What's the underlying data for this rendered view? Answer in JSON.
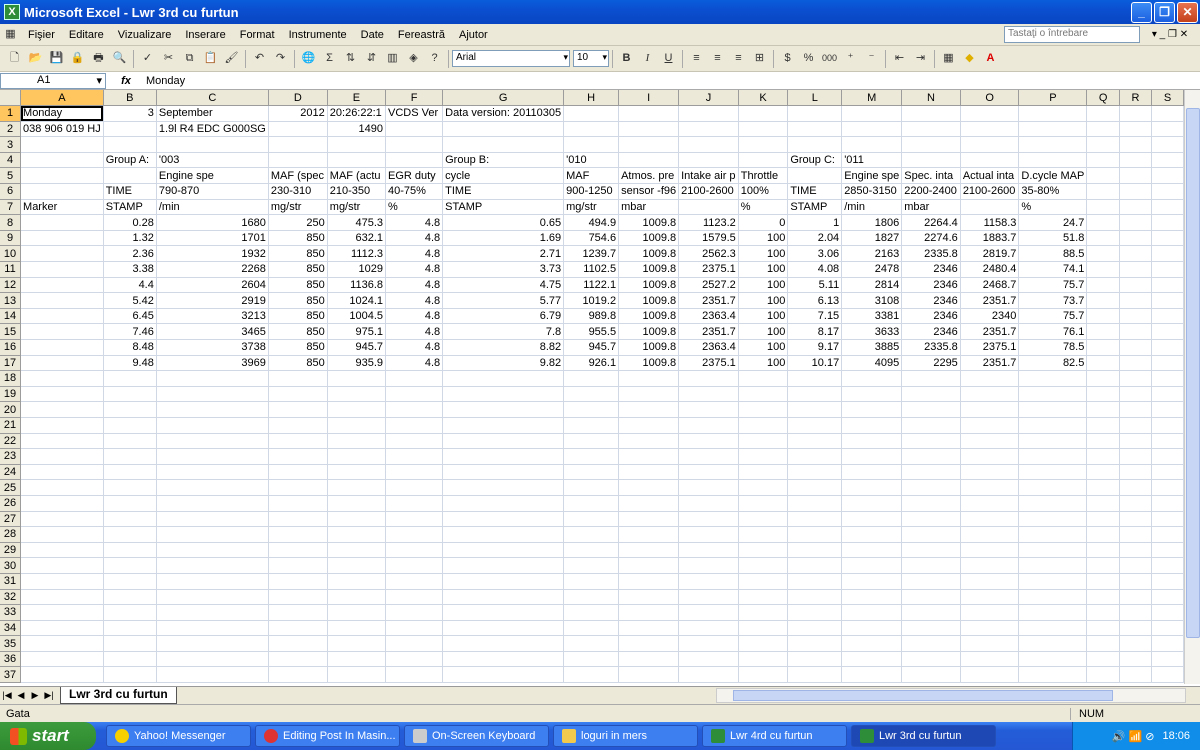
{
  "window": {
    "title": "Microsoft Excel - Lwr 3rd cu furtun",
    "app_icon": "X"
  },
  "menu": [
    "Fişier",
    "Editare",
    "Vizualizare",
    "Inserare",
    "Format",
    "Instrumente",
    "Date",
    "Fereastră",
    "Ajutor"
  ],
  "ask_box": {
    "placeholder": "Tastaţi o întrebare"
  },
  "toolbar": {
    "font": "Arial",
    "size": "10",
    "percent": "%",
    "thousands": "000"
  },
  "formula_bar": {
    "cell": "A1",
    "fx": "fx",
    "value": "Monday"
  },
  "columns": [
    "A",
    "B",
    "C",
    "D",
    "E",
    "F",
    "G",
    "H",
    "I",
    "J",
    "K",
    "L",
    "M",
    "N",
    "O",
    "P",
    "Q",
    "R",
    "S"
  ],
  "rows": [
    [
      "Monday",
      "3",
      "September",
      "2012",
      "20:26:22:1",
      "VCDS Ver",
      "Data version: 20110305",
      "",
      "",
      "",
      "",
      "",
      "",
      "",
      "",
      "",
      "",
      "",
      ""
    ],
    [
      "038 906 019 HJ",
      "",
      "1.9l R4 EDC G000SG",
      "",
      "1490",
      "",
      "",
      "",
      "",
      "",
      "",
      "",
      "",
      "",
      "",
      "",
      "",
      "",
      ""
    ],
    [
      "",
      "",
      "",
      "",
      "",
      "",
      "",
      "",
      "",
      "",
      "",
      "",
      "",
      "",
      "",
      "",
      "",
      "",
      ""
    ],
    [
      "",
      "Group A:",
      "'003",
      "",
      "",
      "",
      "Group B:",
      "'010",
      "",
      "",
      "",
      "Group C:",
      "'011",
      "",
      "",
      "",
      "",
      "",
      ""
    ],
    [
      "",
      "",
      "Engine spe",
      "MAF (spec",
      "MAF (actu",
      "EGR duty",
      "cycle",
      "MAF",
      "Atmos. pre",
      "Intake air p",
      "Throttle",
      "",
      "Engine spe",
      "Spec. inta",
      "Actual inta",
      "D.cycle MAP",
      "",
      "",
      ""
    ],
    [
      "",
      "TIME",
      "790-870",
      "230-310",
      "210-350",
      "40-75%",
      "TIME",
      "900-1250",
      "sensor -f96",
      "2100-2600",
      "100%",
      "TIME",
      "2850-3150",
      "2200-2400",
      "2100-2600",
      "35-80%",
      "",
      "",
      ""
    ],
    [
      "Marker",
      "STAMP",
      "/min",
      "mg/str",
      "mg/str",
      "%",
      "STAMP",
      "mg/str",
      "mbar",
      "",
      "%",
      "STAMP",
      "/min",
      "mbar",
      "",
      "%",
      "",
      "",
      ""
    ],
    [
      "",
      "0.28",
      "1680",
      "250",
      "475.3",
      "4.8",
      "0.65",
      "494.9",
      "1009.8",
      "1123.2",
      "0",
      "1",
      "1806",
      "2264.4",
      "1158.3",
      "24.7",
      "",
      "",
      ""
    ],
    [
      "",
      "1.32",
      "1701",
      "850",
      "632.1",
      "4.8",
      "1.69",
      "754.6",
      "1009.8",
      "1579.5",
      "100",
      "2.04",
      "1827",
      "2274.6",
      "1883.7",
      "51.8",
      "",
      "",
      ""
    ],
    [
      "",
      "2.36",
      "1932",
      "850",
      "1112.3",
      "4.8",
      "2.71",
      "1239.7",
      "1009.8",
      "2562.3",
      "100",
      "3.06",
      "2163",
      "2335.8",
      "2819.7",
      "88.5",
      "",
      "",
      ""
    ],
    [
      "",
      "3.38",
      "2268",
      "850",
      "1029",
      "4.8",
      "3.73",
      "1102.5",
      "1009.8",
      "2375.1",
      "100",
      "4.08",
      "2478",
      "2346",
      "2480.4",
      "74.1",
      "",
      "",
      ""
    ],
    [
      "",
      "4.4",
      "2604",
      "850",
      "1136.8",
      "4.8",
      "4.75",
      "1122.1",
      "1009.8",
      "2527.2",
      "100",
      "5.11",
      "2814",
      "2346",
      "2468.7",
      "75.7",
      "",
      "",
      ""
    ],
    [
      "",
      "5.42",
      "2919",
      "850",
      "1024.1",
      "4.8",
      "5.77",
      "1019.2",
      "1009.8",
      "2351.7",
      "100",
      "6.13",
      "3108",
      "2346",
      "2351.7",
      "73.7",
      "",
      "",
      ""
    ],
    [
      "",
      "6.45",
      "3213",
      "850",
      "1004.5",
      "4.8",
      "6.79",
      "989.8",
      "1009.8",
      "2363.4",
      "100",
      "7.15",
      "3381",
      "2346",
      "2340",
      "75.7",
      "",
      "",
      ""
    ],
    [
      "",
      "7.46",
      "3465",
      "850",
      "975.1",
      "4.8",
      "7.8",
      "955.5",
      "1009.8",
      "2351.7",
      "100",
      "8.17",
      "3633",
      "2346",
      "2351.7",
      "76.1",
      "",
      "",
      ""
    ],
    [
      "",
      "8.48",
      "3738",
      "850",
      "945.7",
      "4.8",
      "8.82",
      "945.7",
      "1009.8",
      "2363.4",
      "100",
      "9.17",
      "3885",
      "2335.8",
      "2375.1",
      "78.5",
      "",
      "",
      ""
    ],
    [
      "",
      "9.48",
      "3969",
      "850",
      "935.9",
      "4.8",
      "9.82",
      "926.1",
      "1009.8",
      "2375.1",
      "100",
      "10.17",
      "4095",
      "2295",
      "2351.7",
      "82.5",
      "",
      "",
      ""
    ]
  ],
  "empty_rows_from": 18,
  "empty_rows_to": 37,
  "sheet_tab": "Lwr 3rd cu furtun",
  "status": {
    "left": "Gata",
    "num": "NUM"
  },
  "taskbar": {
    "start": "start",
    "items": [
      "Yahoo! Messenger",
      "Editing Post In Masin...",
      "On-Screen Keyboard",
      "loguri in mers",
      "Lwr 4rd cu furtun",
      "Lwr 3rd cu furtun"
    ],
    "time": "18:06"
  }
}
